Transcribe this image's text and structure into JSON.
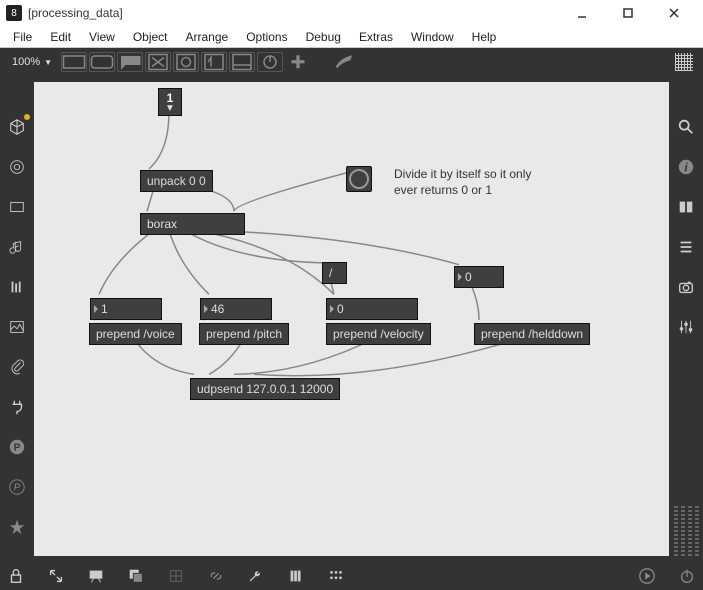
{
  "window": {
    "title": "[processing_data]"
  },
  "menu": {
    "items": [
      "File",
      "Edit",
      "View",
      "Object",
      "Arrange",
      "Options",
      "Debug",
      "Extras",
      "Window",
      "Help"
    ]
  },
  "topbar": {
    "zoom": "100%"
  },
  "canvas": {
    "inlet_value": "1",
    "comment_line1": "Divide it by itself so it only",
    "comment_line2": "ever returns 0 or 1",
    "boxes": {
      "unpack": "unpack 0 0",
      "borax": "borax",
      "divide": "/",
      "num_voice": "1",
      "num_pitch": "46",
      "num_velocity": "0",
      "num_helddown": "0",
      "prepend_voice": "prepend /voice",
      "prepend_pitch": "prepend /pitch",
      "prepend_velocity": "prepend /velocity",
      "prepend_helddown": "prepend /helddown",
      "udpsend": "udpsend 127.0.0.1 12000"
    }
  }
}
